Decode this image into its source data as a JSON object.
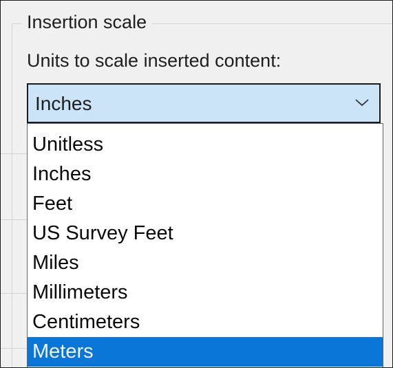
{
  "group": {
    "title": "Insertion scale"
  },
  "prompt": {
    "label": "Units to scale inserted content:"
  },
  "combo": {
    "value": "Inches",
    "icon": "chevron-down-icon"
  },
  "dropdown": {
    "options": [
      {
        "label": "Unitless",
        "selected": false
      },
      {
        "label": "Inches",
        "selected": false
      },
      {
        "label": "Feet",
        "selected": false
      },
      {
        "label": "US Survey Feet",
        "selected": false
      },
      {
        "label": "Miles",
        "selected": false
      },
      {
        "label": "Millimeters",
        "selected": false
      },
      {
        "label": "Centimeters",
        "selected": false
      },
      {
        "label": "Meters",
        "selected": true
      }
    ]
  },
  "colors": {
    "highlight": "#0a76d8",
    "combo_background": "#cce4f7",
    "dialog_background": "#f0f0f0"
  }
}
